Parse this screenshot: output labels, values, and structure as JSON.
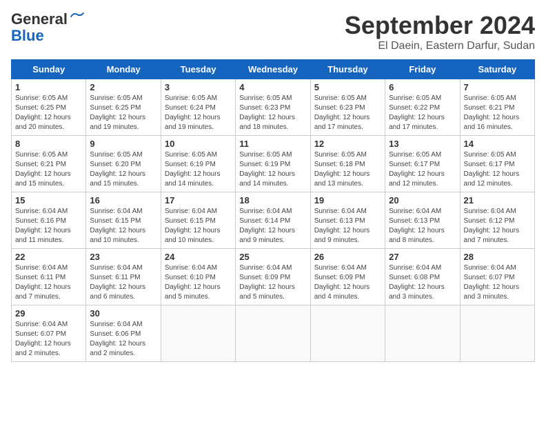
{
  "header": {
    "logo_line1": "General",
    "logo_line2": "Blue",
    "month": "September 2024",
    "location": "El Daein, Eastern Darfur, Sudan"
  },
  "weekdays": [
    "Sunday",
    "Monday",
    "Tuesday",
    "Wednesday",
    "Thursday",
    "Friday",
    "Saturday"
  ],
  "weeks": [
    [
      {
        "day": "1",
        "info": "Sunrise: 6:05 AM\nSunset: 6:25 PM\nDaylight: 12 hours\nand 20 minutes."
      },
      {
        "day": "2",
        "info": "Sunrise: 6:05 AM\nSunset: 6:25 PM\nDaylight: 12 hours\nand 19 minutes."
      },
      {
        "day": "3",
        "info": "Sunrise: 6:05 AM\nSunset: 6:24 PM\nDaylight: 12 hours\nand 19 minutes."
      },
      {
        "day": "4",
        "info": "Sunrise: 6:05 AM\nSunset: 6:23 PM\nDaylight: 12 hours\nand 18 minutes."
      },
      {
        "day": "5",
        "info": "Sunrise: 6:05 AM\nSunset: 6:23 PM\nDaylight: 12 hours\nand 17 minutes."
      },
      {
        "day": "6",
        "info": "Sunrise: 6:05 AM\nSunset: 6:22 PM\nDaylight: 12 hours\nand 17 minutes."
      },
      {
        "day": "7",
        "info": "Sunrise: 6:05 AM\nSunset: 6:21 PM\nDaylight: 12 hours\nand 16 minutes."
      }
    ],
    [
      {
        "day": "8",
        "info": "Sunrise: 6:05 AM\nSunset: 6:21 PM\nDaylight: 12 hours\nand 15 minutes."
      },
      {
        "day": "9",
        "info": "Sunrise: 6:05 AM\nSunset: 6:20 PM\nDaylight: 12 hours\nand 15 minutes."
      },
      {
        "day": "10",
        "info": "Sunrise: 6:05 AM\nSunset: 6:19 PM\nDaylight: 12 hours\nand 14 minutes."
      },
      {
        "day": "11",
        "info": "Sunrise: 6:05 AM\nSunset: 6:19 PM\nDaylight: 12 hours\nand 14 minutes."
      },
      {
        "day": "12",
        "info": "Sunrise: 6:05 AM\nSunset: 6:18 PM\nDaylight: 12 hours\nand 13 minutes."
      },
      {
        "day": "13",
        "info": "Sunrise: 6:05 AM\nSunset: 6:17 PM\nDaylight: 12 hours\nand 12 minutes."
      },
      {
        "day": "14",
        "info": "Sunrise: 6:05 AM\nSunset: 6:17 PM\nDaylight: 12 hours\nand 12 minutes."
      }
    ],
    [
      {
        "day": "15",
        "info": "Sunrise: 6:04 AM\nSunset: 6:16 PM\nDaylight: 12 hours\nand 11 minutes."
      },
      {
        "day": "16",
        "info": "Sunrise: 6:04 AM\nSunset: 6:15 PM\nDaylight: 12 hours\nand 10 minutes."
      },
      {
        "day": "17",
        "info": "Sunrise: 6:04 AM\nSunset: 6:15 PM\nDaylight: 12 hours\nand 10 minutes."
      },
      {
        "day": "18",
        "info": "Sunrise: 6:04 AM\nSunset: 6:14 PM\nDaylight: 12 hours\nand 9 minutes."
      },
      {
        "day": "19",
        "info": "Sunrise: 6:04 AM\nSunset: 6:13 PM\nDaylight: 12 hours\nand 9 minutes."
      },
      {
        "day": "20",
        "info": "Sunrise: 6:04 AM\nSunset: 6:13 PM\nDaylight: 12 hours\nand 8 minutes."
      },
      {
        "day": "21",
        "info": "Sunrise: 6:04 AM\nSunset: 6:12 PM\nDaylight: 12 hours\nand 7 minutes."
      }
    ],
    [
      {
        "day": "22",
        "info": "Sunrise: 6:04 AM\nSunset: 6:11 PM\nDaylight: 12 hours\nand 7 minutes."
      },
      {
        "day": "23",
        "info": "Sunrise: 6:04 AM\nSunset: 6:11 PM\nDaylight: 12 hours\nand 6 minutes."
      },
      {
        "day": "24",
        "info": "Sunrise: 6:04 AM\nSunset: 6:10 PM\nDaylight: 12 hours\nand 5 minutes."
      },
      {
        "day": "25",
        "info": "Sunrise: 6:04 AM\nSunset: 6:09 PM\nDaylight: 12 hours\nand 5 minutes."
      },
      {
        "day": "26",
        "info": "Sunrise: 6:04 AM\nSunset: 6:09 PM\nDaylight: 12 hours\nand 4 minutes."
      },
      {
        "day": "27",
        "info": "Sunrise: 6:04 AM\nSunset: 6:08 PM\nDaylight: 12 hours\nand 3 minutes."
      },
      {
        "day": "28",
        "info": "Sunrise: 6:04 AM\nSunset: 6:07 PM\nDaylight: 12 hours\nand 3 minutes."
      }
    ],
    [
      {
        "day": "29",
        "info": "Sunrise: 6:04 AM\nSunset: 6:07 PM\nDaylight: 12 hours\nand 2 minutes."
      },
      {
        "day": "30",
        "info": "Sunrise: 6:04 AM\nSunset: 6:06 PM\nDaylight: 12 hours\nand 2 minutes."
      },
      null,
      null,
      null,
      null,
      null
    ]
  ]
}
